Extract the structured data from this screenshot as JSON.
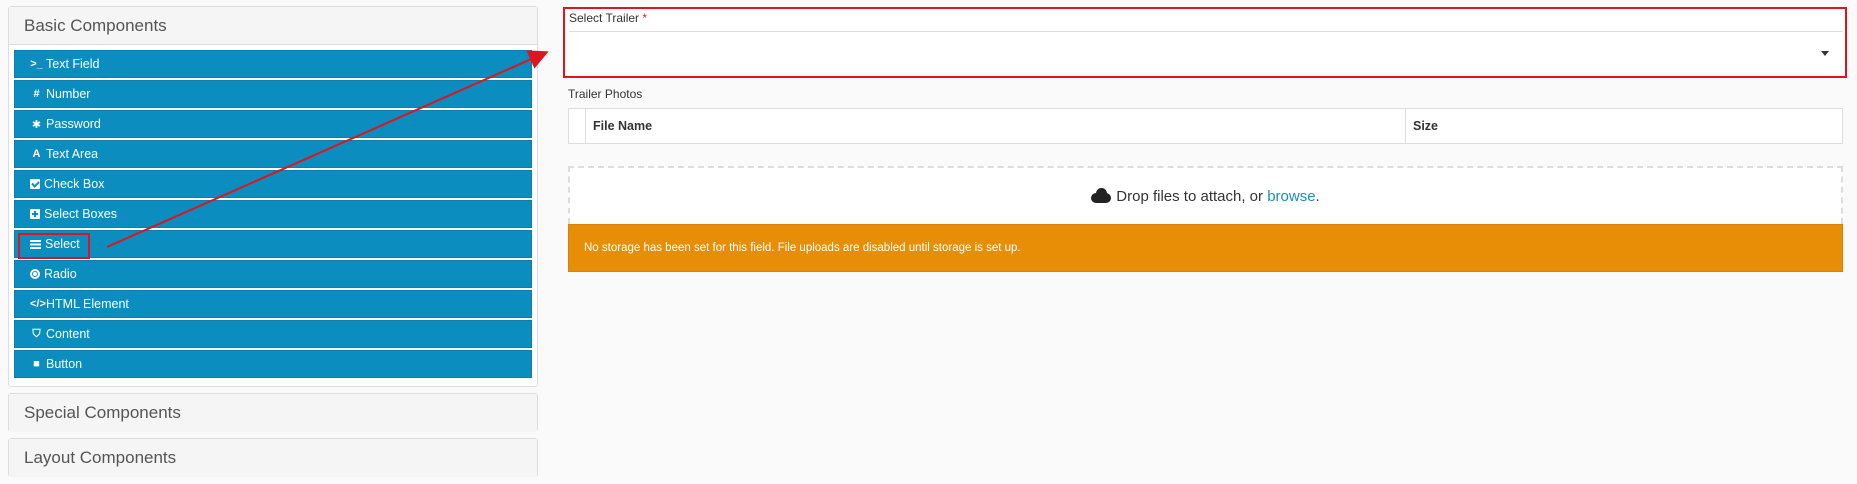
{
  "sidebar": {
    "basic_title": "Basic Components",
    "special_title": "Special Components",
    "layout_title": "Layout Components",
    "items": [
      {
        "label": "Text Field",
        "icon": "terminal-icon",
        "glyph": ">_"
      },
      {
        "label": "Number",
        "icon": "hash-icon",
        "glyph": "#"
      },
      {
        "label": "Password",
        "icon": "asterisk-icon",
        "glyph": "✱"
      },
      {
        "label": "Text Area",
        "icon": "font-icon",
        "glyph": "A"
      },
      {
        "label": "Check Box",
        "icon": "check-square-icon",
        "glyph": ""
      },
      {
        "label": "Select Boxes",
        "icon": "plus-square-icon",
        "glyph": ""
      },
      {
        "label": "Select",
        "icon": "list-icon",
        "glyph": ""
      },
      {
        "label": "Radio",
        "icon": "dot-circle-icon",
        "glyph": ""
      },
      {
        "label": "HTML Element",
        "icon": "code-icon",
        "glyph": "</>"
      },
      {
        "label": "Content",
        "icon": "html5-icon",
        "glyph": "⛉"
      },
      {
        "label": "Button",
        "icon": "stop-icon",
        "glyph": "■"
      }
    ]
  },
  "form": {
    "select_label": "Select Trailer",
    "required_mark": "*",
    "photos_label": "Trailer Photos",
    "table_headers": [
      "File Name",
      "Size"
    ],
    "drop_text": "Drop files to attach, or",
    "browse_text": "browse",
    "drop_suffix": ".",
    "warning": "No storage has been set for this field. File uploads are disabled until storage is set up."
  },
  "colors": {
    "component_button": "#0b8ebf",
    "annotation": "#e0141c",
    "warning": "#e88e06",
    "link": "#1a8dc2"
  }
}
